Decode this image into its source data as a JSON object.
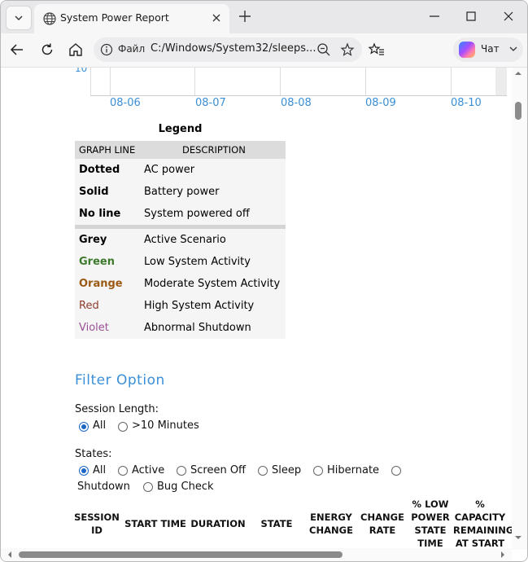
{
  "tab": {
    "title": "System Power Report"
  },
  "address": {
    "protocol": "Файл",
    "url": "C:/Windows/System32/sleeps..."
  },
  "copilot": {
    "label": "Чат"
  },
  "chart": {
    "ytick": "10",
    "xticks": [
      "08-06",
      "08-07",
      "08-08",
      "08-09",
      "08-10"
    ]
  },
  "legend": {
    "title": "Legend",
    "headers": [
      "GRAPH LINE",
      "DESCRIPTION"
    ],
    "line_rows": [
      {
        "key": "Dotted",
        "desc": "AC power"
      },
      {
        "key": "Solid",
        "desc": "Battery power"
      },
      {
        "key": "No line",
        "desc": "System powered off"
      }
    ],
    "color_rows": [
      {
        "key": "Grey",
        "desc": "Active Scenario",
        "color": "#000000"
      },
      {
        "key": "Green",
        "desc": "Low System Activity",
        "color": "#3d7a2c"
      },
      {
        "key": "Orange",
        "desc": "Moderate System Activity",
        "color": "#9a5a14"
      },
      {
        "key": "Red",
        "desc": "High System Activity",
        "color": "#8f3b2a"
      },
      {
        "key": "Violet",
        "desc": "Abnormal Shutdown",
        "color": "#9b4f95"
      }
    ]
  },
  "filter": {
    "title": "Filter Option",
    "session_length": {
      "label": "Session Length:",
      "options": [
        "All",
        ">10 Minutes"
      ],
      "selected": "All"
    },
    "states": {
      "label": "States:",
      "options": [
        "All",
        "Active",
        "Screen Off",
        "Sleep",
        "Hibernate",
        "Shutdown",
        "Bug Check"
      ],
      "selected": "All"
    }
  },
  "table_headers": [
    [
      "SESSION",
      "ID"
    ],
    [
      "START TIME"
    ],
    [
      "DURATION"
    ],
    [
      "STATE"
    ],
    [
      "ENERGY",
      "CHANGE"
    ],
    [
      "CHANGE",
      "RATE"
    ],
    [
      "% LOW",
      "POWER",
      "STATE",
      "TIME"
    ],
    [
      "%",
      "CAPACITY",
      "REMAINING",
      "AT START"
    ]
  ],
  "colors": {
    "accent": "#3b8fd6",
    "radio": "#1a66c4"
  }
}
